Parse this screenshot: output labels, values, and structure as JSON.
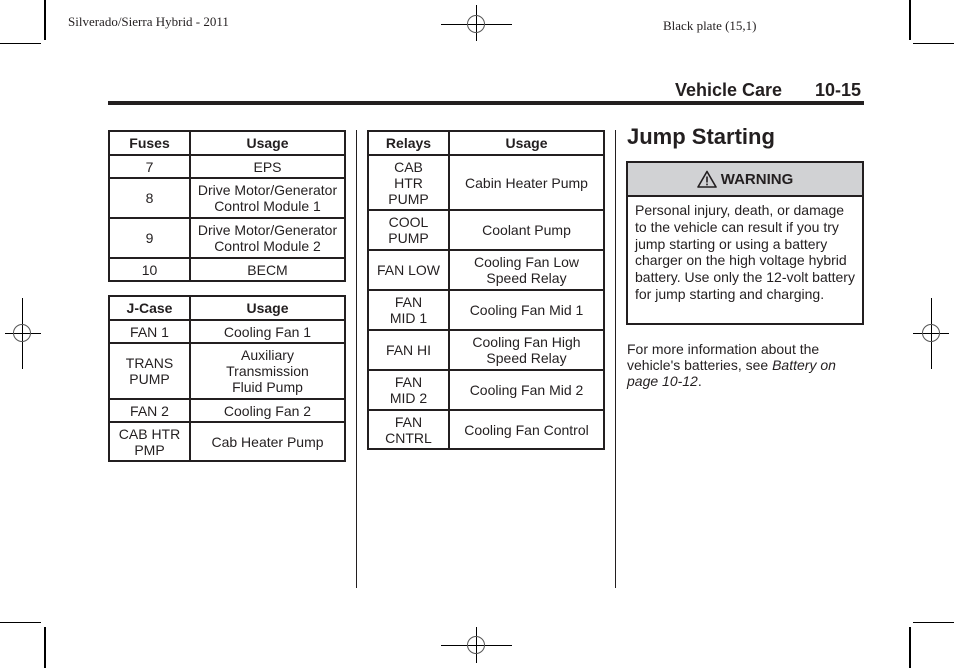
{
  "print_marks": {
    "left_header": "Silverado/Sierra Hybrid - 2011",
    "right_header": "Black plate (15,1)"
  },
  "header": {
    "section": "Vehicle Care",
    "page_number": "10-15"
  },
  "fuses_table": {
    "columns": [
      "Fuses",
      "Usage"
    ],
    "rows": [
      {
        "id": "7",
        "usage": "EPS"
      },
      {
        "id": "8",
        "usage": "Drive Motor/Generator Control Module 1"
      },
      {
        "id": "9",
        "usage": "Drive Motor/Generator Control Module 2"
      },
      {
        "id": "10",
        "usage": "BECM"
      }
    ]
  },
  "jcase_table": {
    "columns": [
      "J-Case",
      "Usage"
    ],
    "rows": [
      {
        "id": "FAN 1",
        "usage": "Cooling Fan 1"
      },
      {
        "id": "TRANS PUMP",
        "usage": "Auxiliary Transmission Fluid Pump"
      },
      {
        "id": "FAN 2",
        "usage": "Cooling Fan 2"
      },
      {
        "id": "CAB HTR PMP",
        "usage": "Cab Heater Pump"
      }
    ]
  },
  "relays_table": {
    "columns": [
      "Relays",
      "Usage"
    ],
    "rows": [
      {
        "id": "CAB HTR PUMP",
        "usage": "Cabin Heater Pump"
      },
      {
        "id": "COOL PUMP",
        "usage": "Coolant Pump"
      },
      {
        "id": "FAN LOW",
        "usage": "Cooling Fan Low Speed Relay"
      },
      {
        "id": "FAN MID 1",
        "usage": "Cooling Fan Mid 1"
      },
      {
        "id": "FAN HI",
        "usage": "Cooling Fan High Speed Relay"
      },
      {
        "id": "FAN MID 2",
        "usage": "Cooling Fan Mid 2"
      },
      {
        "id": "FAN CNTRL",
        "usage": "Cooling Fan Control"
      }
    ]
  },
  "jump_starting": {
    "title": "Jump Starting",
    "warning": {
      "icon": "warning-triangle-icon",
      "label": "WARNING",
      "text": "Personal injury, death, or damage to the vehicle can result if you try jump starting or using a battery charger on the high voltage hybrid battery. Use only the 12-volt battery for jump starting and charging."
    },
    "info_text": "For more information about the vehicle's batteries, see",
    "info_link": "Battery on page 10-12",
    "info_end": "."
  }
}
